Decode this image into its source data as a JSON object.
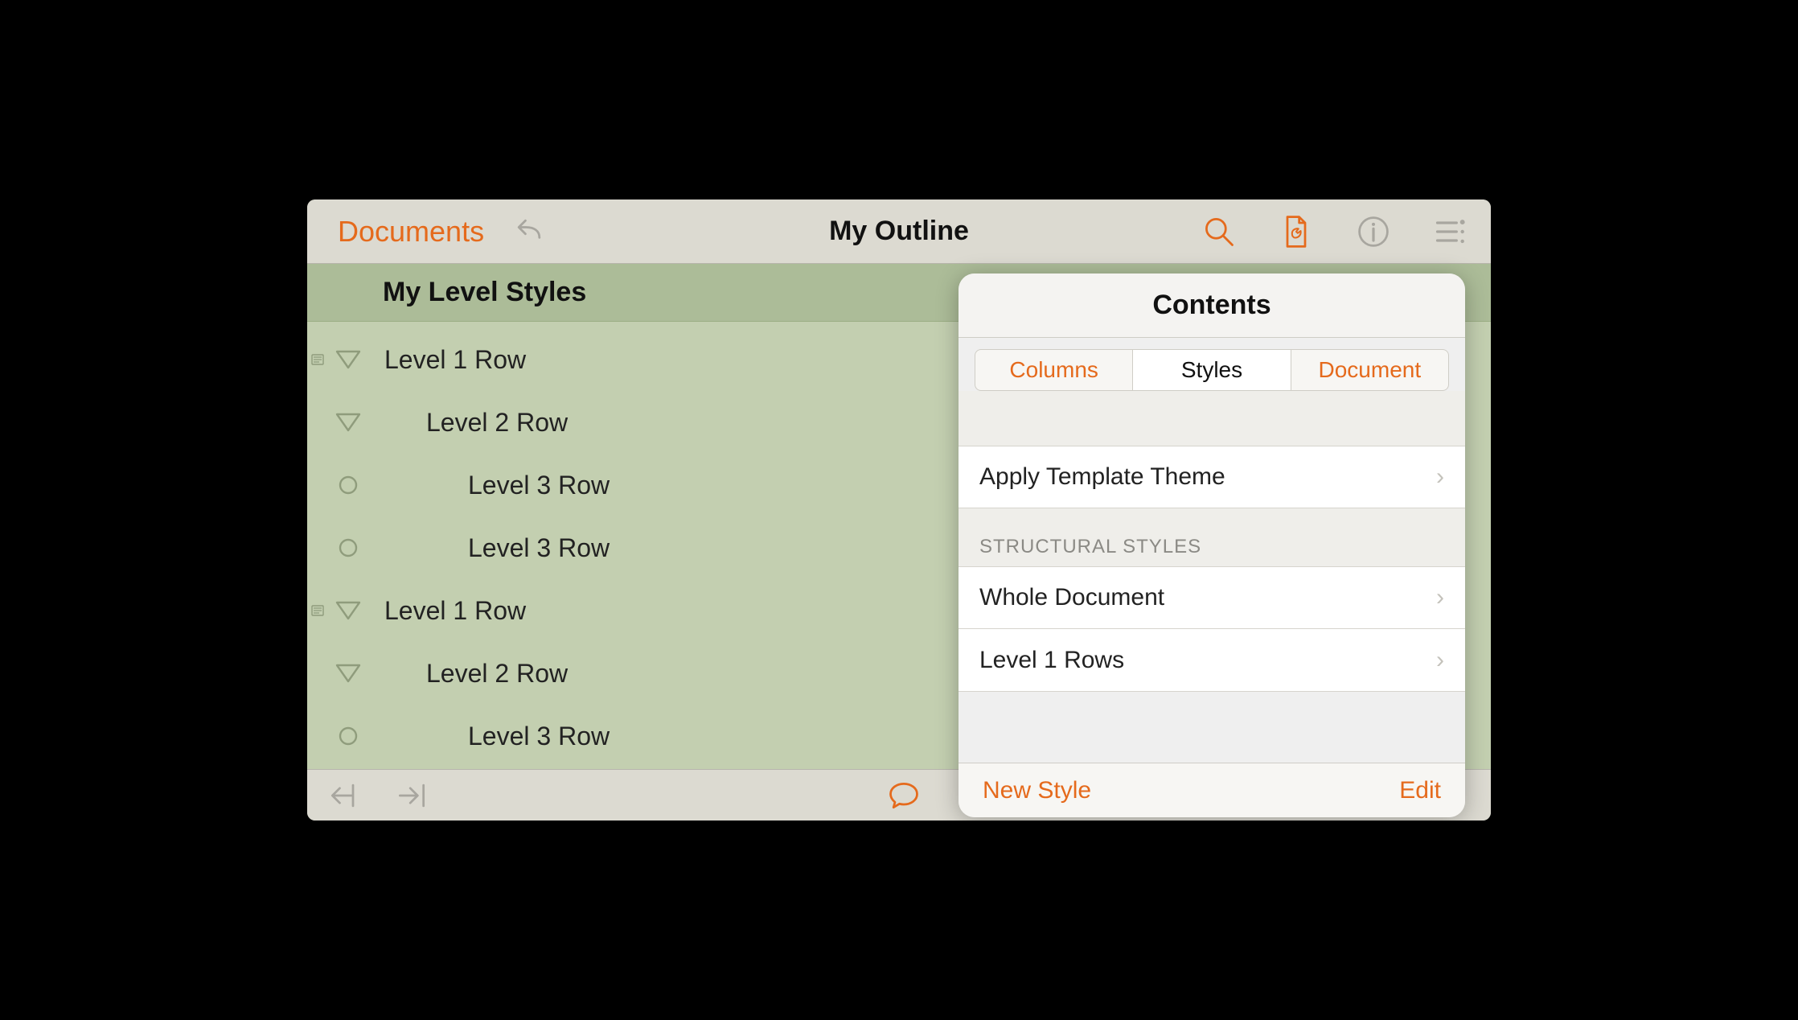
{
  "toolbar": {
    "documents_label": "Documents",
    "title": "My Outline"
  },
  "outline": {
    "title": "My Level Styles",
    "rows": [
      {
        "label": "Level 1 Row",
        "level": 1,
        "handle": "triangle",
        "note": true
      },
      {
        "label": "Level 2 Row",
        "level": 2,
        "handle": "triangle",
        "note": false
      },
      {
        "label": "Level 3 Row",
        "level": 3,
        "handle": "circle",
        "note": false
      },
      {
        "label": "Level 3 Row",
        "level": 3,
        "handle": "circle",
        "note": false
      },
      {
        "label": "Level 1 Row",
        "level": 1,
        "handle": "triangle",
        "note": true
      },
      {
        "label": "Level 2 Row",
        "level": 2,
        "handle": "triangle",
        "note": false
      },
      {
        "label": "Level 3 Row",
        "level": 3,
        "handle": "circle",
        "note": false
      }
    ]
  },
  "popover": {
    "title": "Contents",
    "tabs": {
      "columns": "Columns",
      "styles": "Styles",
      "document": "Document"
    },
    "apply_theme": "Apply Template Theme",
    "section_header": "STRUCTURAL STYLES",
    "items": [
      "Whole Document",
      "Level 1 Rows"
    ],
    "footer": {
      "new_style": "New Style",
      "edit": "Edit"
    }
  }
}
